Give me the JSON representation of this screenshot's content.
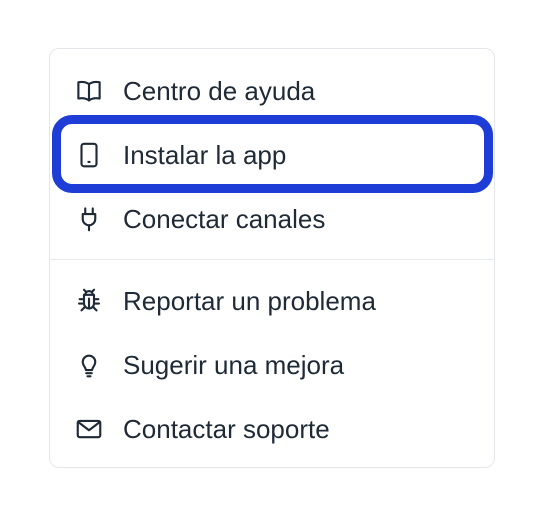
{
  "menu": {
    "items": [
      {
        "label": "Centro de ayuda",
        "icon": "book-open-icon"
      },
      {
        "label": "Instalar la app",
        "icon": "mobile-device-icon"
      },
      {
        "label": "Conectar canales",
        "icon": "plug-icon"
      },
      {
        "label": "Reportar un problema",
        "icon": "bug-icon"
      },
      {
        "label": "Sugerir una mejora",
        "icon": "lightbulb-icon"
      },
      {
        "label": "Contactar soporte",
        "icon": "envelope-icon"
      }
    ]
  },
  "highlight": {
    "target": "Instalar la app",
    "color": "#1d3dd6"
  }
}
